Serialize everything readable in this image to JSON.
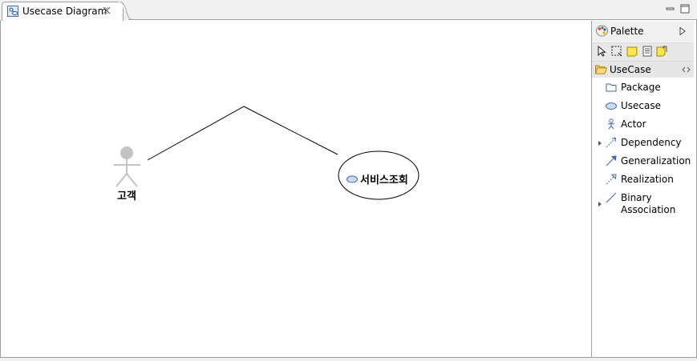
{
  "editor": {
    "tab_title": "Usecase Diagram"
  },
  "diagram": {
    "actor": {
      "name": "고객"
    },
    "usecase": {
      "name": "서비스조회"
    }
  },
  "palette": {
    "title": "Palette",
    "drawer": {
      "label": "UseCase"
    },
    "items": [
      {
        "label": "Package",
        "icon": "package-icon"
      },
      {
        "label": "Usecase",
        "icon": "usecase-icon"
      },
      {
        "label": "Actor",
        "icon": "actor-icon"
      },
      {
        "label": "Dependency",
        "icon": "dependency-icon"
      },
      {
        "label": "Generalization",
        "icon": "generalization-icon"
      },
      {
        "label": "Realization",
        "icon": "realization-icon"
      },
      {
        "label": "Binary",
        "label2": "Association",
        "icon": "association-icon"
      }
    ]
  }
}
